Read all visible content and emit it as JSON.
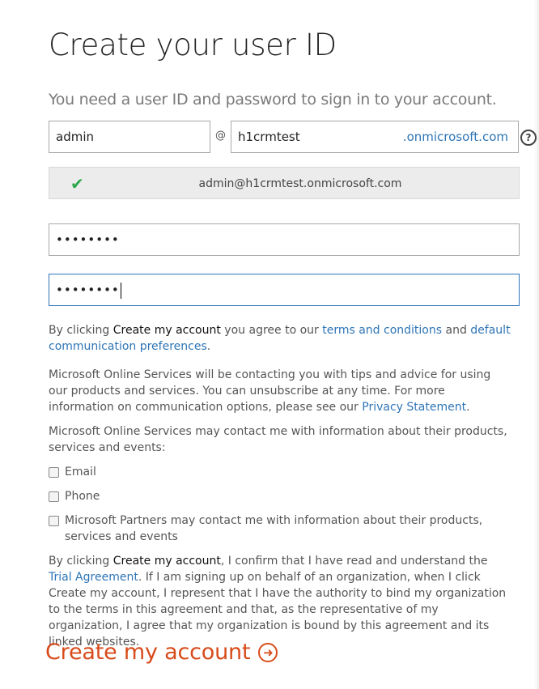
{
  "header": {
    "title": "Create your user ID",
    "subtitle": "You need a user ID and password to sign in to your account."
  },
  "user_id": {
    "username_value": "admin",
    "at_symbol": "@",
    "domain_value": "h1crmtest",
    "domain_suffix": ".onmicrosoft.com",
    "help_symbol": "?"
  },
  "verification": {
    "icon": "check-icon",
    "text": "admin@h1crmtest.onmicrosoft.com",
    "color": "#2ba84a"
  },
  "password": {
    "value_masked": "••••••••",
    "confirm_value_masked": "••••••••"
  },
  "agreement_1": {
    "prefix": "By clicking ",
    "bold": "Create my account",
    "middle": " you agree to our ",
    "terms_link": "terms and conditions",
    "and": " and ",
    "comm_link": "default communication preferences",
    "suffix": "."
  },
  "contact_info": {
    "text": "Microsoft Online Services will be contacting you with tips and advice for using our products and services. You can unsubscribe at any time. For more information on communication options, please see our ",
    "privacy_link": "Privacy Statement",
    "suffix": "."
  },
  "contact_prompt": "Microsoft Online Services may contact me with information about their products, services and events:",
  "checkboxes": [
    {
      "label": "Email",
      "checked": false
    },
    {
      "label": "Phone",
      "checked": false
    },
    {
      "label": "Microsoft Partners may contact me with information about their products, services and events",
      "checked": false
    }
  ],
  "agreement_2": {
    "prefix": "By clicking ",
    "bold": "Create my account",
    "middle": ", I confirm that I have read and understand the ",
    "trial_link": "Trial Agreement",
    "suffix": ". If I am signing up on behalf of an organization, when I click Create my account, I represent that I have the authority to bind my organization to the terms in this agreement and that, as the representative of my organization, I agree that my organization is bound by this agreement and its linked websites."
  },
  "cta": {
    "label": "Create my account",
    "icon": "arrow-circle-right-icon",
    "color": "#d84b1a"
  },
  "colors": {
    "link": "#2e75b6",
    "focus_border": "#2e75b6"
  }
}
